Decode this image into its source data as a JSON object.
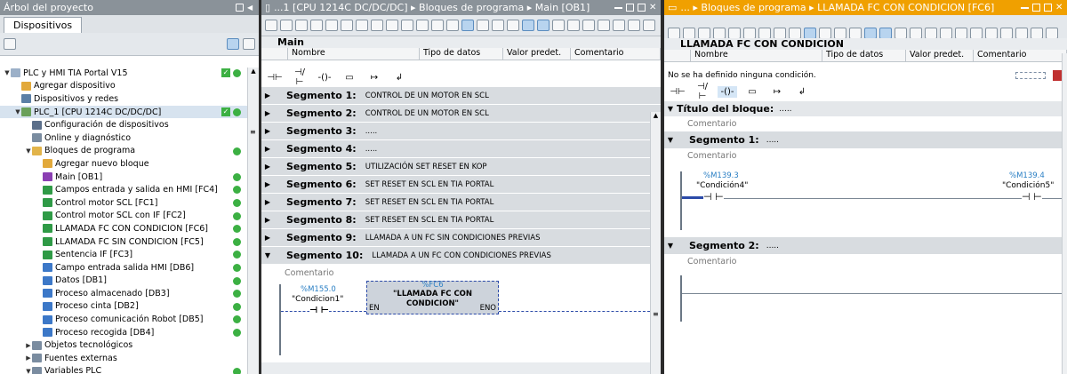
{
  "left": {
    "title": "Árbol del proyecto",
    "tab": "Dispositivos",
    "tree": [
      {
        "label": "PLC y HMI TIA Portal V15",
        "indent": 0,
        "exp": "▼",
        "icon": "#9cb0c8",
        "chk": true,
        "st": true
      },
      {
        "label": "Agregar dispositivo",
        "indent": 1,
        "exp": "",
        "icon": "#e2a93b"
      },
      {
        "label": "Dispositivos y redes",
        "indent": 1,
        "exp": "",
        "icon": "#5b7fa6"
      },
      {
        "label": "PLC_1 [CPU 1214C DC/DC/DC]",
        "indent": 1,
        "exp": "▼",
        "icon": "#6aa05a",
        "chk": true,
        "st": true,
        "hl": true
      },
      {
        "label": "Configuración de dispositivos",
        "indent": 2,
        "exp": "",
        "icon": "#5b6f8a"
      },
      {
        "label": "Online y diagnóstico",
        "indent": 2,
        "exp": "",
        "icon": "#7a8ca0"
      },
      {
        "label": "Bloques de programa",
        "indent": 2,
        "exp": "▼",
        "icon": "#e2b44a",
        "st": true
      },
      {
        "label": "Agregar nuevo bloque",
        "indent": 3,
        "exp": "",
        "icon": "#e2a93b"
      },
      {
        "label": "Main [OB1]",
        "indent": 3,
        "exp": "",
        "icon": "#8b3fb3",
        "st": true
      },
      {
        "label": "Campos entrada y salida en HMI [FC4]",
        "indent": 3,
        "exp": "",
        "icon": "#2f9a46",
        "st": true
      },
      {
        "label": "Control motor SCL [FC1]",
        "indent": 3,
        "exp": "",
        "icon": "#2f9a46",
        "st": true
      },
      {
        "label": "Control motor SCL con IF [FC2]",
        "indent": 3,
        "exp": "",
        "icon": "#2f9a46",
        "st": true
      },
      {
        "label": "LLAMADA FC CON CONDICION [FC6]",
        "indent": 3,
        "exp": "",
        "icon": "#2f9a46",
        "st": true
      },
      {
        "label": "LLAMADA FC SIN CONDICION [FC5]",
        "indent": 3,
        "exp": "",
        "icon": "#2f9a46",
        "st": true
      },
      {
        "label": "Sentencia IF [FC3]",
        "indent": 3,
        "exp": "",
        "icon": "#2f9a46",
        "st": true
      },
      {
        "label": "Campo entrada salida HMI [DB6]",
        "indent": 3,
        "exp": "",
        "icon": "#3c78c8",
        "st": true
      },
      {
        "label": "Datos [DB1]",
        "indent": 3,
        "exp": "",
        "icon": "#3c78c8",
        "st": true
      },
      {
        "label": "Proceso almacenado [DB3]",
        "indent": 3,
        "exp": "",
        "icon": "#3c78c8",
        "st": true
      },
      {
        "label": "Proceso cinta [DB2]",
        "indent": 3,
        "exp": "",
        "icon": "#3c78c8",
        "st": true
      },
      {
        "label": "Proceso comunicación Robot [DB5]",
        "indent": 3,
        "exp": "",
        "icon": "#3c78c8",
        "st": true
      },
      {
        "label": "Proceso recogida [DB4]",
        "indent": 3,
        "exp": "",
        "icon": "#3c78c8",
        "st": true
      },
      {
        "label": "Objetos tecnológicos",
        "indent": 2,
        "exp": "▶",
        "icon": "#7a8ca0"
      },
      {
        "label": "Fuentes externas",
        "indent": 2,
        "exp": "▶",
        "icon": "#7a8ca0"
      },
      {
        "label": "Variables PLC",
        "indent": 2,
        "exp": "▼",
        "icon": "#7a8ca0",
        "st": true
      }
    ]
  },
  "mid": {
    "title": "...1 [CPU 1214C DC/DC/DC]  ▸  Bloques de programa  ▸  Main [OB1]",
    "block": "Main",
    "cols": {
      "name": "Nombre",
      "type": "Tipo de datos",
      "def": "Valor predet.",
      "com": "Comentario"
    },
    "segments": [
      {
        "label": "Segmento 1:",
        "comment": "CONTROL DE UN MOTOR EN SCL"
      },
      {
        "label": "Segmento 2:",
        "comment": "CONTROL DE UN MOTOR EN SCL"
      },
      {
        "label": "Segmento 3:",
        "comment": "....."
      },
      {
        "label": "Segmento 4:",
        "comment": "....."
      },
      {
        "label": "Segmento 5:",
        "comment": "UTILIZACIÓN SET RESET EN    KOP"
      },
      {
        "label": "Segmento 6:",
        "comment": "SET RESET EN SCL EN TIA PORTAL"
      },
      {
        "label": "Segmento 7:",
        "comment": "SET RESET EN SCL EN TIA PORTAL"
      },
      {
        "label": "Segmento 8:",
        "comment": "SET RESET EN SCL EN TIA PORTAL"
      },
      {
        "label": "Segmento 9:",
        "comment": "LLAMADA A UN FC SIN CONDICIONES PREVIAS"
      },
      {
        "label": "Segmento 10:",
        "comment": "LLAMADA A UN FC CON CONDICIONES PREVIAS"
      }
    ],
    "seg_comment": "Comentario",
    "contact_addr": "%M155.0",
    "contact_name": "\"Condicion1\"",
    "fc_addr": "%FC6",
    "fc_name": "\"LLAMADA FC CON CONDICION\"",
    "en": "EN",
    "eno": "ENO"
  },
  "right": {
    "title": "...  ▸  Bloques de programa  ▸  LLAMADA FC CON CONDICION [FC6]",
    "block": "LLAMADA FC CON CONDICION",
    "cols": {
      "name": "Nombre",
      "type": "Tipo de datos",
      "def": "Valor predet.",
      "com": "Comentario"
    },
    "no_cond": "No se ha definido ninguna condición.",
    "block_title": "Título del bloque:",
    "block_title_dots": ".....",
    "comment": "Comentario",
    "seg1": "Segmento 1:",
    "seg1_dots": ".....",
    "seg2": "Segmento 2:",
    "seg2_dots": ".....",
    "c1_addr": "%M139.3",
    "c1_name": "\"Condición4\"",
    "c2_addr": "%M139.4",
    "c2_name": "\"Condición5\""
  },
  "colors": {
    "status_green": "#3cb043",
    "orange_title": "#f0a000",
    "gray_title": "#8a9299",
    "address_blue": "#2a7fc4"
  }
}
